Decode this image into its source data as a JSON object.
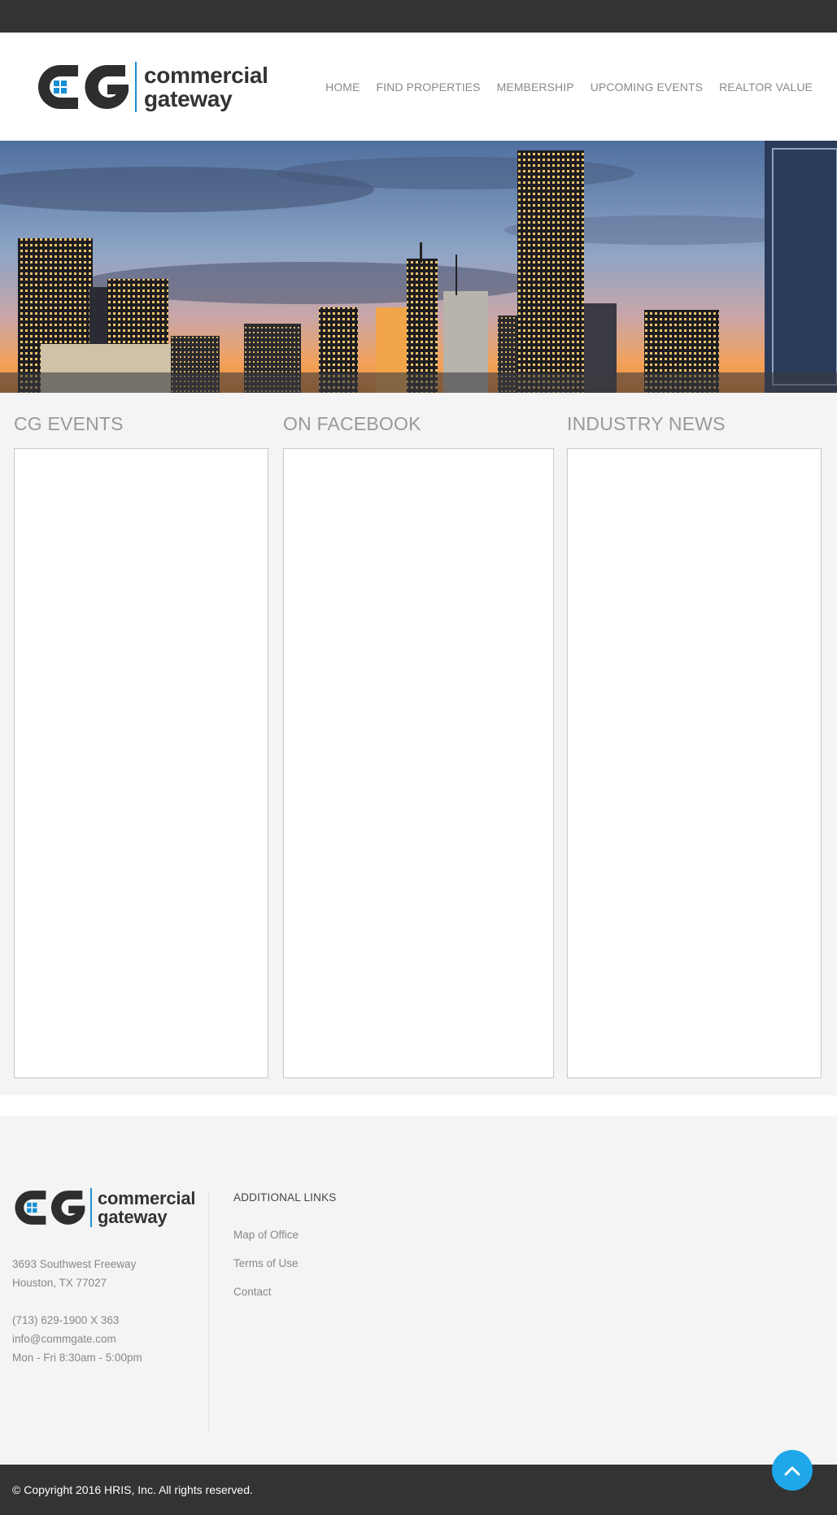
{
  "header": {
    "logo": {
      "mark": "CG",
      "line1": "commercial",
      "line2": "gateway"
    },
    "nav": [
      "HOME",
      "FIND PROPERTIES",
      "MEMBERSHIP",
      "UPCOMING EVENTS",
      "REALTOR VALUE"
    ]
  },
  "sections": [
    {
      "title": "CG EVENTS"
    },
    {
      "title": "ON FACEBOOK"
    },
    {
      "title": "INDUSTRY NEWS"
    }
  ],
  "footer": {
    "logo": {
      "mark": "CG",
      "line1": "commercial",
      "line2": "gateway"
    },
    "address_line1": "3693 Southwest Freeway",
    "address_line2": "Houston, TX 77027",
    "phone": "(713) 629-1900 X 363",
    "email": "info@commgate.com",
    "hours": "Mon - Fri 8:30am - 5:00pm",
    "links_title": "ADDITIONAL LINKS",
    "links": [
      "Map of Office",
      "Terms of Use",
      "Contact"
    ],
    "copyright": "© Copyright 2016 HRIS, Inc. All rights reserved."
  },
  "colors": {
    "dark_bar": "#333333",
    "accent": "#1fa7ea",
    "logo_blue": "#1a8fd1"
  },
  "icons": {
    "back_to_top": "chevron-up-icon"
  }
}
